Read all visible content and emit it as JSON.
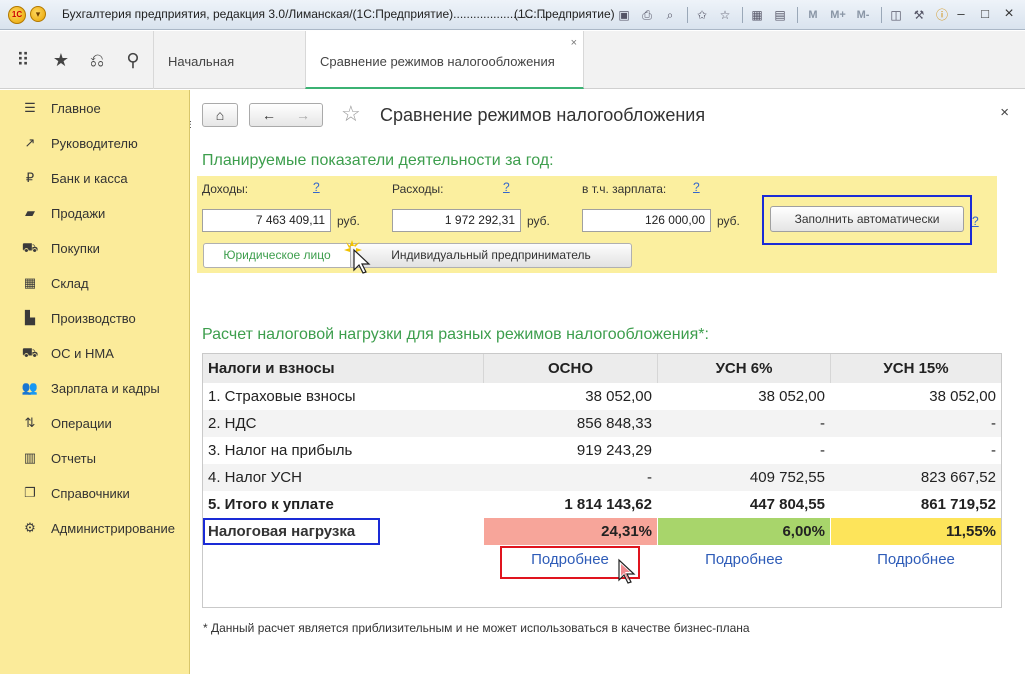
{
  "window": {
    "title": "Бухгалтерия предприятия, редакция 3.0/Лиманская/(1С:Предприятие).............................",
    "platform": "(1С:Предприятие)",
    "toolbar_icons": [
      "save-icon",
      "print-icon",
      "preview-icon",
      "add-favorite-icon",
      "favorites-icon",
      "calendar-icon",
      "calculator-icon"
    ],
    "memory_buttons": [
      "M",
      "M+",
      "M-"
    ],
    "window_buttons": [
      "minimize-icon",
      "maximize-icon",
      "close-icon"
    ]
  },
  "tabs": [
    {
      "label": "Начальная страница",
      "active": false
    },
    {
      "label": "Сравнение режимов налогообложения",
      "active": true
    }
  ],
  "tab_close": "×",
  "sidebar": {
    "items": [
      {
        "label": "Главное",
        "icon": "menu-lines-icon"
      },
      {
        "label": "Руководителю",
        "icon": "trend-chart-icon"
      },
      {
        "label": "Банк и касса",
        "icon": "ruble-coin-icon"
      },
      {
        "label": "Продажи",
        "icon": "shopping-bag-icon"
      },
      {
        "label": "Покупки",
        "icon": "shopping-cart-icon"
      },
      {
        "label": "Склад",
        "icon": "warehouse-boxes-icon"
      },
      {
        "label": "Производство",
        "icon": "factory-icon"
      },
      {
        "label": "ОС и НМА",
        "icon": "truck-icon"
      },
      {
        "label": "Зарплата и кадры",
        "icon": "people-icon"
      },
      {
        "label": "Операции",
        "icon": "operations-icon"
      },
      {
        "label": "Отчеты",
        "icon": "bar-chart-icon"
      },
      {
        "label": "Справочники",
        "icon": "books-icon"
      },
      {
        "label": "Администрирование",
        "icon": "gear-icon"
      }
    ]
  },
  "page": {
    "title": "Сравнение режимов налогообложения",
    "close": "×"
  },
  "plan": {
    "title": "Планируемые показатели деятельности за год:",
    "income_label": "Доходы:",
    "expense_label": "Расходы:",
    "salary_label": "в т.ч. зарплата:",
    "help": "?",
    "income_value": "7 463 409,11",
    "expense_value": "1 972 292,31",
    "salary_value": "126 000,00",
    "currency": "руб.",
    "fill_button": "Заполнить автоматически",
    "entity_legal": "Юридическое лицо",
    "entity_individual": "Индивидуальный предприниматель",
    "selected_entity": "Юридическое лицо"
  },
  "calc": {
    "title": "Расчет налоговой нагрузки для разных режимов налогообложения*:",
    "headers": [
      "Налоги и взносы",
      "ОСНО",
      "УСН 6%",
      "УСН 15%"
    ],
    "rows": [
      [
        "1. Страховые взносы",
        "38 052,00",
        "38 052,00",
        "38 052,00"
      ],
      [
        "2. НДС",
        "856 848,33",
        "-",
        "-"
      ],
      [
        "3. Налог на прибыль",
        "919 243,29",
        "-",
        "-"
      ],
      [
        "4. Налог УСН",
        "-",
        "409 752,55",
        "823 667,52"
      ],
      [
        "5. Итого к уплате",
        "1 814 143,62",
        "447 804,55",
        "861 719,52"
      ]
    ],
    "load_label": "Налоговая нагрузка",
    "load_values": [
      "24,31%",
      "6,00%",
      "11,55%"
    ],
    "load_colors": [
      "#f7a59a",
      "#a8d56b",
      "#fde45a"
    ],
    "details_link": "Подробнее"
  },
  "footnote": "* Данный расчет является приблизительным и не может использоваться в качестве бизнес-плана"
}
